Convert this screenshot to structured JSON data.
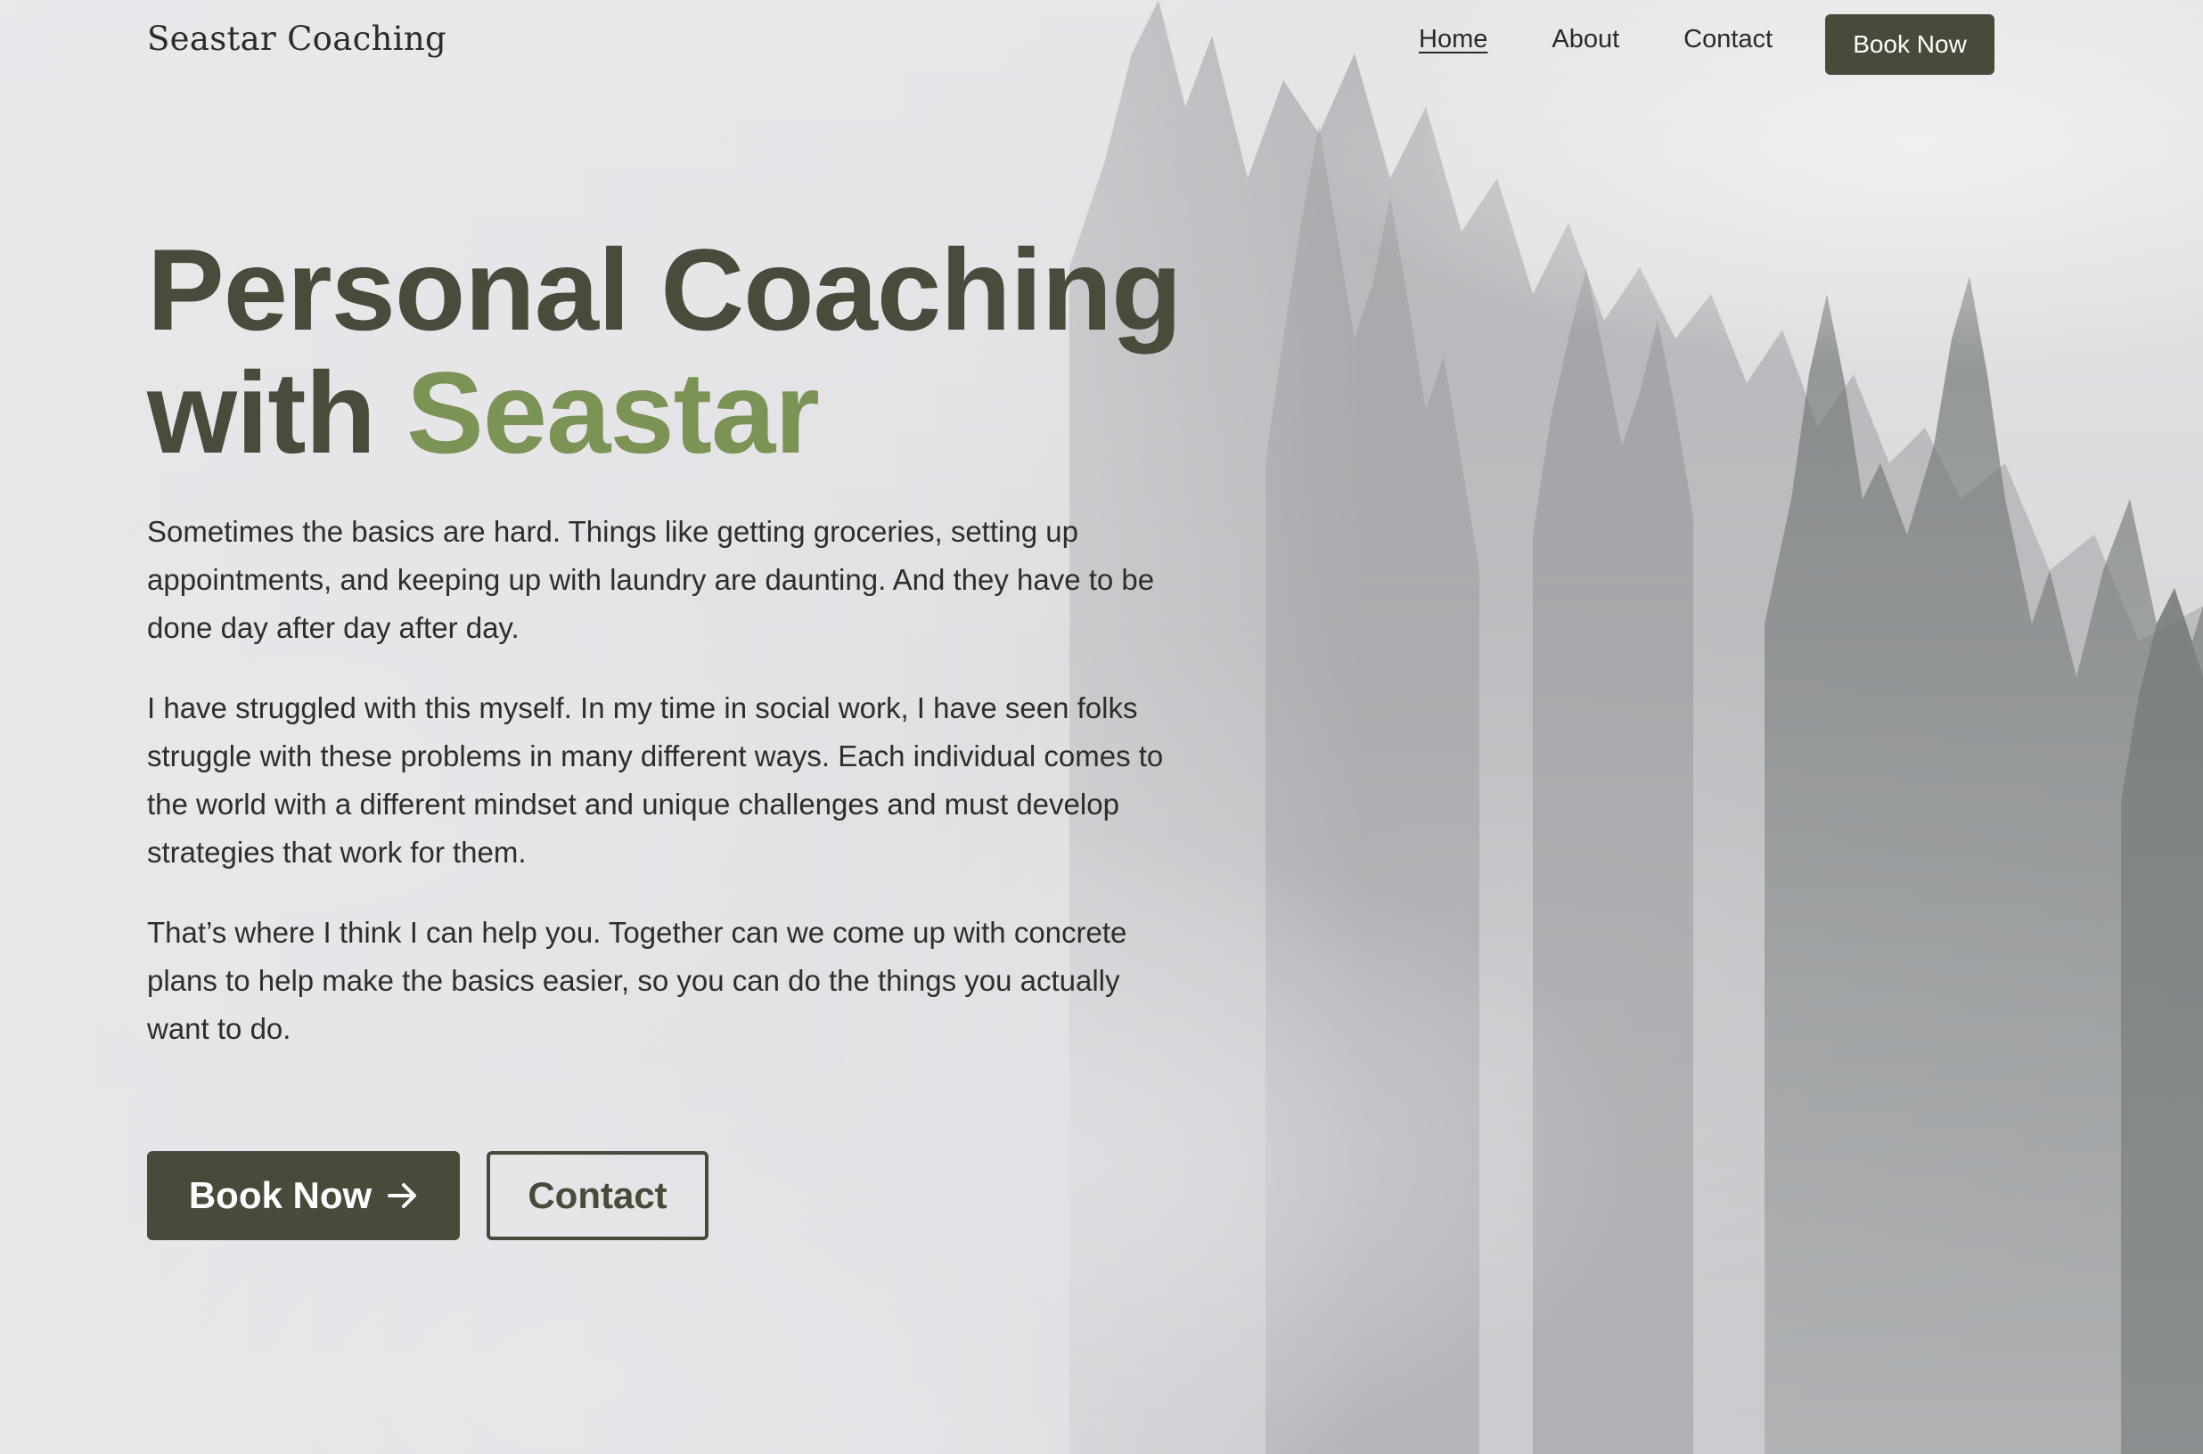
{
  "header": {
    "brand": "Seastar Coaching",
    "nav": [
      {
        "label": "Home",
        "active": true
      },
      {
        "label": "About",
        "active": false
      },
      {
        "label": "Contact",
        "active": false
      }
    ],
    "cta_label": "Book Now"
  },
  "hero": {
    "title_line1": "Personal Coaching",
    "title_line2_prefix": "with",
    "title_line2_accent": "Seastar",
    "paragraphs": [
      "Sometimes the basics are hard. Things like getting groceries, setting up appointments, and keeping up with laundry are daunting. And they have to be done day after day after day.",
      "I have struggled with this myself. In my time in social work, I have seen folks struggle with these problems in many different ways. Each individual comes to the world with a different mindset and unique challenges and must develop strategies that work for them.",
      "That’s where I think I can help you. Together can we come up with concrete plans to help make the basics easier, so you can do the things you actually want to do."
    ],
    "primary_button": "Book Now",
    "primary_button_icon": "arrow-right-icon",
    "secondary_button": "Contact"
  },
  "colors": {
    "primary": "#474b3a",
    "accent": "#7b9354",
    "text": "#2d2d2d"
  }
}
